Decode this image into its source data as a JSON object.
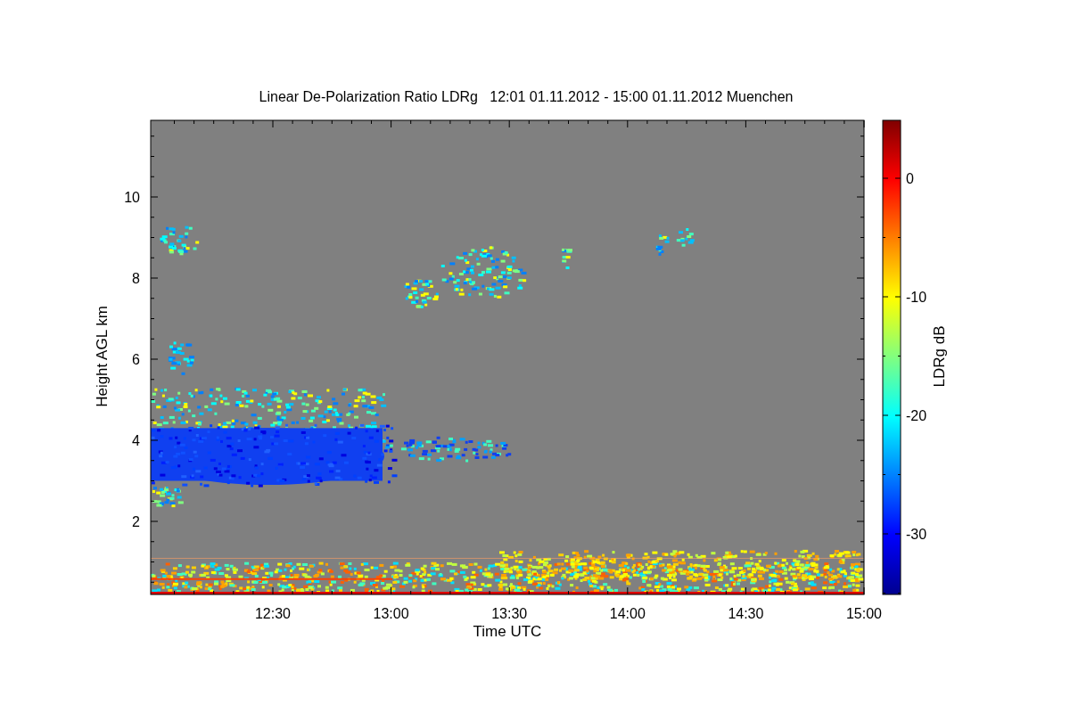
{
  "plot": {
    "title": "Linear De-Polarization Ratio LDRg   12:01 01.11.2012 - 15:00 01.11.2012 Muenchen",
    "xlabel": "Time UTC",
    "ylabel": "Height AGL km",
    "xticks": [
      "12:30",
      "13:00",
      "13:30",
      "14:00",
      "14:30",
      "15:00"
    ],
    "yticks": [
      "10",
      "8",
      "6",
      "4",
      "2"
    ]
  },
  "colorbar": {
    "label": "LDRg dB",
    "ticks": [
      "0",
      "-10",
      "-20",
      "-30"
    ]
  }
}
